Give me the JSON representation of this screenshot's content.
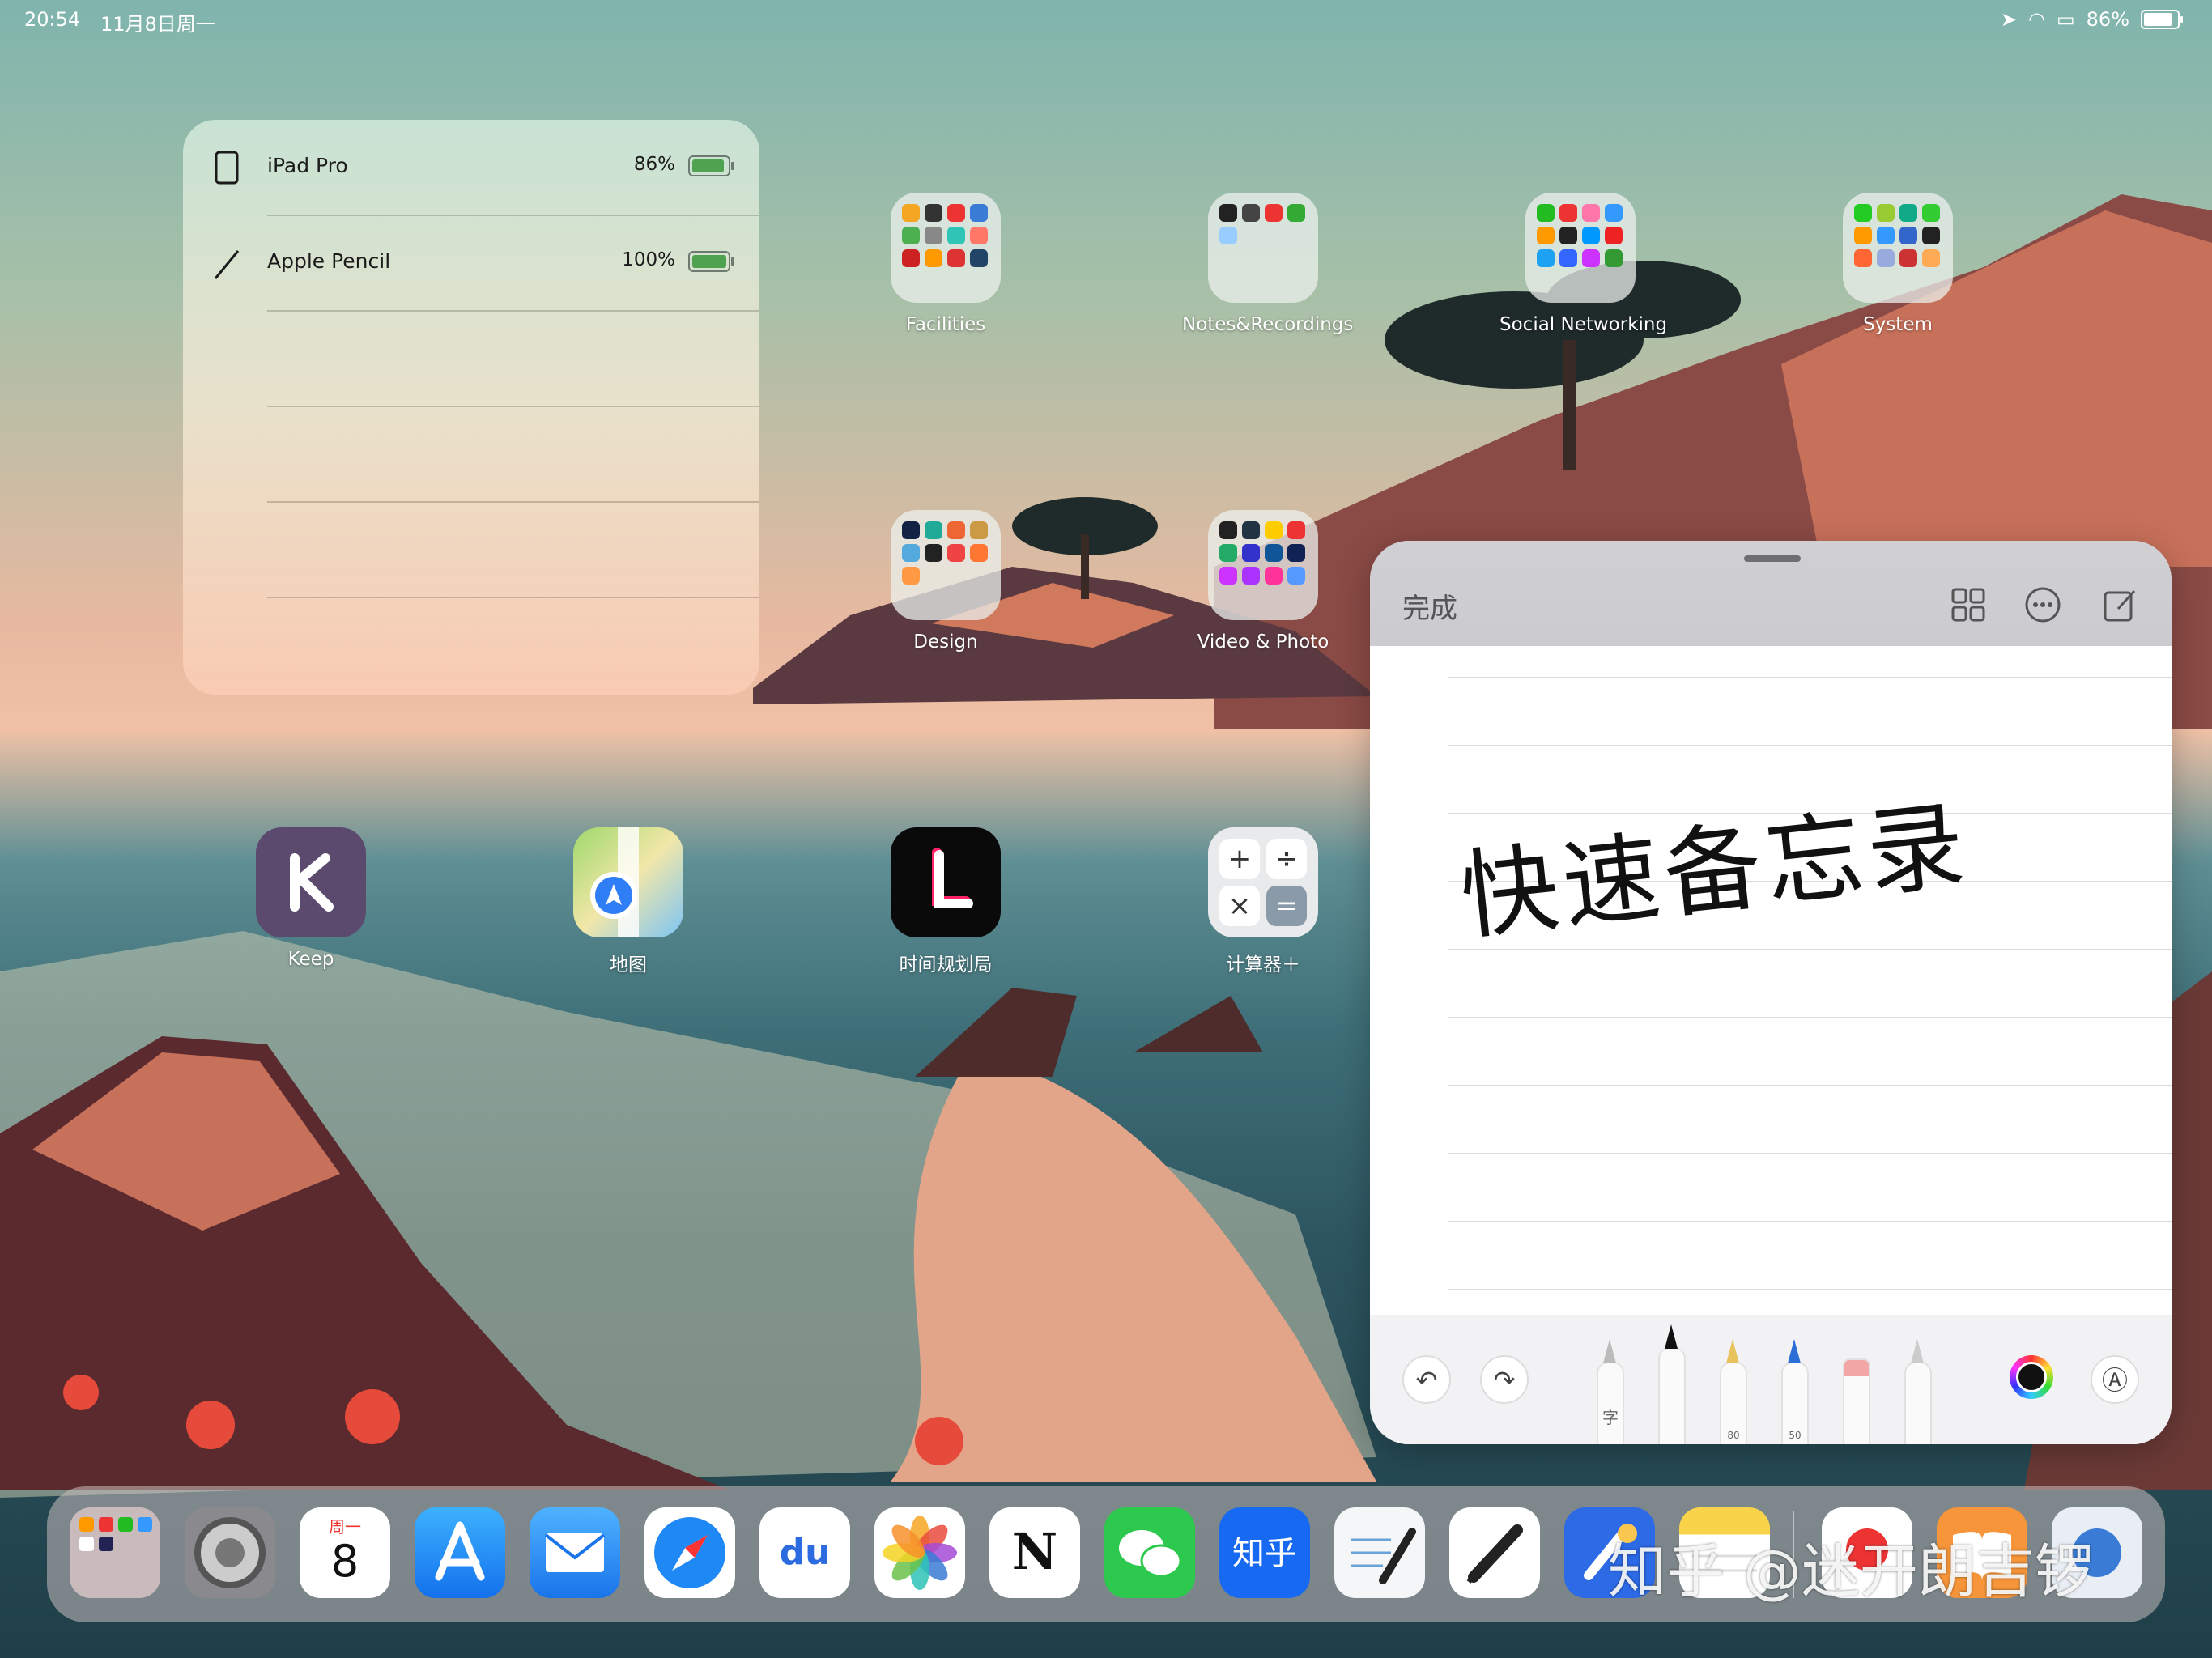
{
  "status_bar": {
    "time": "20:54",
    "date": "11月8日周一",
    "battery": "86%"
  },
  "battery_widget": {
    "devices": [
      {
        "name": "iPad Pro",
        "percent": "86%"
      },
      {
        "name": "Apple Pencil",
        "percent": "100%"
      }
    ]
  },
  "home": {
    "folders": [
      {
        "label": "Facilities"
      },
      {
        "label": "Notes&Recordings"
      },
      {
        "label": "Social Networking"
      },
      {
        "label": "System"
      },
      {
        "label": "Design"
      },
      {
        "label": "Video & Photo"
      }
    ],
    "apps": [
      {
        "label": "Keep"
      },
      {
        "label": "地图"
      },
      {
        "label": "时间规划局"
      },
      {
        "label": "计算器＋"
      }
    ]
  },
  "quick_note": {
    "done_label": "完成",
    "handwriting": "快速备忘录",
    "tools": {
      "text_tool": "字",
      "marker_size": "80",
      "pencil_size": "50"
    }
  },
  "dock": {
    "calendar_weekday": "周一",
    "calendar_day": "8",
    "zhihu_label": "知乎",
    "baidu_label": "du",
    "notion_label": "N"
  },
  "watermark": "知乎 @迷开朗吉锣"
}
